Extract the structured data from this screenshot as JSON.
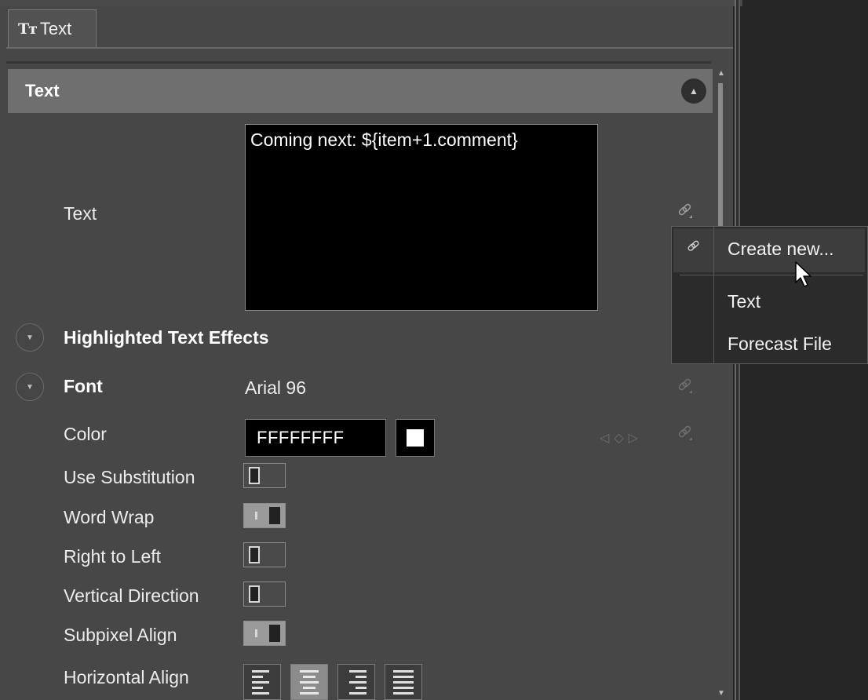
{
  "tab": {
    "icon": "text-size-icon",
    "icon_glyph": "Tт",
    "label": "Text"
  },
  "section": {
    "title": "Text"
  },
  "text_property": {
    "label": "Text",
    "value": "Coming next: ${item+1.comment}"
  },
  "highlighted_effects": {
    "label": "Highlighted Text Effects"
  },
  "font": {
    "label": "Font",
    "value": "Arial 96"
  },
  "color": {
    "label": "Color",
    "value": "FFFFFFFF",
    "swatch": "#ffffff"
  },
  "toggles": [
    {
      "label": "Use Substitution",
      "state": "off"
    },
    {
      "label": "Word Wrap",
      "state": "on"
    },
    {
      "label": "Right to Left",
      "state": "off"
    },
    {
      "label": "Vertical Direction",
      "state": "off"
    },
    {
      "label": "Subpixel Align",
      "state": "on"
    }
  ],
  "horizontal_align": {
    "label": "Horizontal Align",
    "options": [
      "left",
      "center",
      "right",
      "justify"
    ],
    "selected": "center"
  },
  "context_menu": {
    "items": [
      "Create new...",
      "Text",
      "Forecast File"
    ],
    "hovered": "Create new..."
  }
}
